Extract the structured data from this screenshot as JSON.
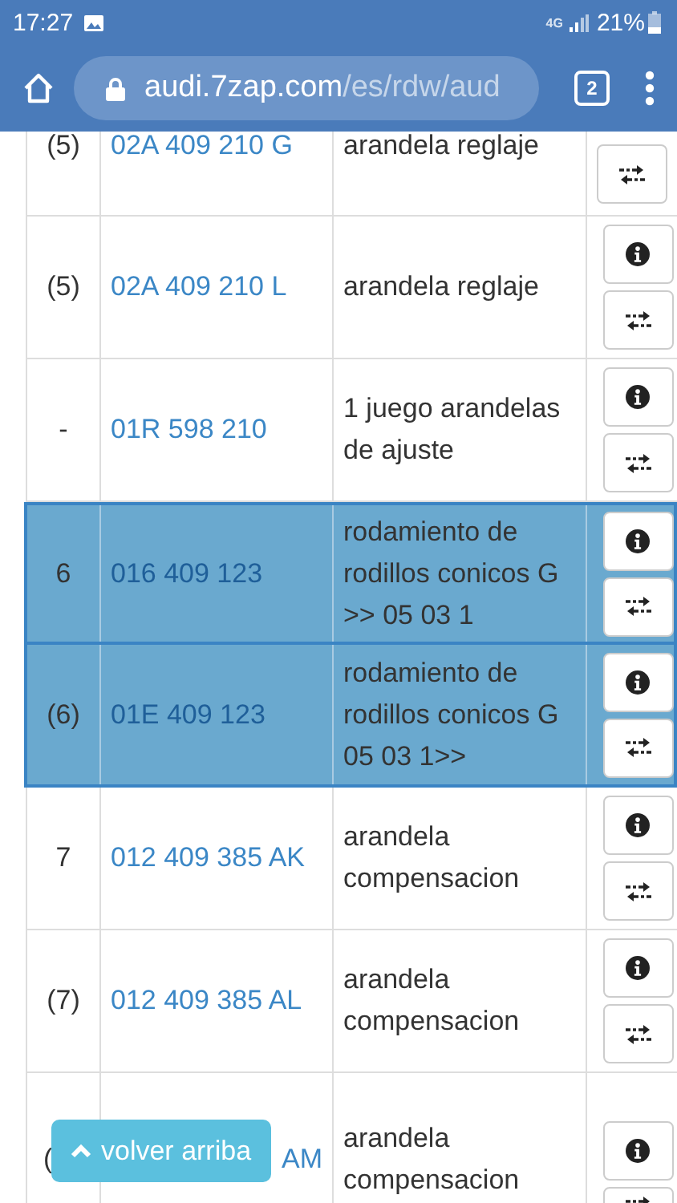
{
  "status_bar": {
    "time": "17:27",
    "network": "4G",
    "battery": "21%"
  },
  "browser": {
    "url_host": "audi.7zap.com",
    "url_path": "/es/rdw/aud",
    "tab_count": "2"
  },
  "parts": [
    {
      "kind": "cut-top",
      "number": "(5)",
      "part": "02A 409 210 G",
      "name": "arandela reglaje",
      "selected": false
    },
    {
      "kind": "full",
      "number": "(5)",
      "part": "02A 409 210 L",
      "name": "arandela reglaje",
      "selected": false
    },
    {
      "kind": "full",
      "number": "-",
      "part": "01R 598 210",
      "name": "1 juego arandelas de ajuste",
      "selected": false
    },
    {
      "kind": "full",
      "number": "6",
      "part": "016 409 123",
      "name": "rodamiento de rodillos conicos G >> 05 03 1",
      "selected": true
    },
    {
      "kind": "full",
      "number": "(6)",
      "part": "01E 409 123",
      "name": "rodamiento de rodillos conicos G 05 03 1>>",
      "selected": true
    },
    {
      "kind": "full",
      "number": "7",
      "part": "012 409 385 AK",
      "name": "arandela compensacion",
      "selected": false
    },
    {
      "kind": "full",
      "number": "(7)",
      "part": "012 409 385 AL",
      "name": "arandela compensacion",
      "selected": false
    },
    {
      "kind": "covered",
      "number": "(",
      "part": "AM",
      "name": "arandela compensacion",
      "selected": false
    }
  ],
  "back_to_top": {
    "label": "volver arriba"
  }
}
